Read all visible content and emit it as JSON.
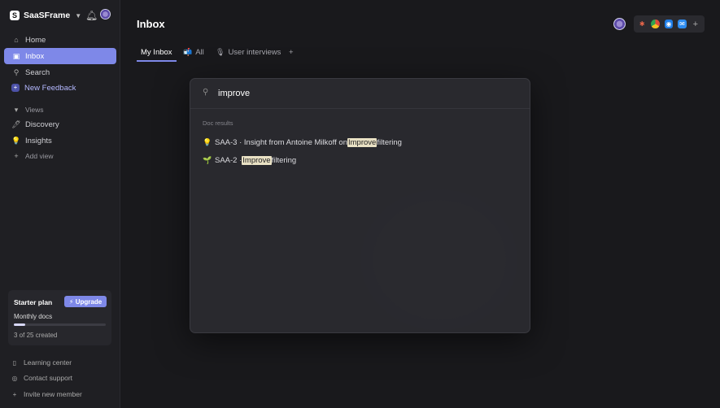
{
  "workspace": {
    "name": "SaaSFrame",
    "logo_glyph": "S"
  },
  "sidebar": {
    "nav": [
      {
        "label": "Home",
        "icon": "home-icon",
        "glyph": "⌂"
      },
      {
        "label": "Inbox",
        "icon": "inbox-icon",
        "glyph": "▣"
      },
      {
        "label": "Search",
        "icon": "search-icon",
        "glyph": "⚲"
      },
      {
        "label": "New Feedback",
        "icon": "plus-square-icon",
        "glyph": "+"
      }
    ],
    "views_label": "Views",
    "views": [
      {
        "label": "Discovery",
        "emoji": "🖊"
      },
      {
        "label": "Insights",
        "emoji": "💡"
      }
    ],
    "add_view": "Add view",
    "plan": {
      "title": "Starter plan",
      "upgrade": "Upgrade",
      "subtitle": "Monthly docs",
      "count_text": "3 of 25 created",
      "fill": 0.12
    },
    "footer": [
      {
        "label": "Learning center",
        "glyph": "▯"
      },
      {
        "label": "Contact support",
        "glyph": "◎"
      },
      {
        "label": "Invite new member",
        "glyph": "+"
      }
    ]
  },
  "main": {
    "title": "Inbox",
    "tabs": [
      {
        "label": "My Inbox",
        "emoji": ""
      },
      {
        "label": "All",
        "emoji": "📬"
      },
      {
        "label": "User interviews",
        "emoji": "🎙"
      },
      {
        "label": "+",
        "emoji": ""
      }
    ]
  },
  "integrations": [
    "slack-icon",
    "chrome-icon",
    "intercom-icon",
    "mail-icon",
    "add-integration-icon"
  ],
  "search": {
    "query": "improve",
    "section": "Doc results",
    "results": [
      {
        "emoji": "💡",
        "before": "SAA-3 · Insight from Antoine Milkoff on ",
        "match": "Improve",
        "after": " filtering"
      },
      {
        "emoji": "🌱",
        "before": "SAA-2 · ",
        "match": "Improve",
        "after": " filtering"
      }
    ]
  },
  "colors": {
    "accent": "#7e88e8",
    "background": "#19191c",
    "sidebar": "#1f1f23",
    "highlight": "#e9e1c4"
  }
}
